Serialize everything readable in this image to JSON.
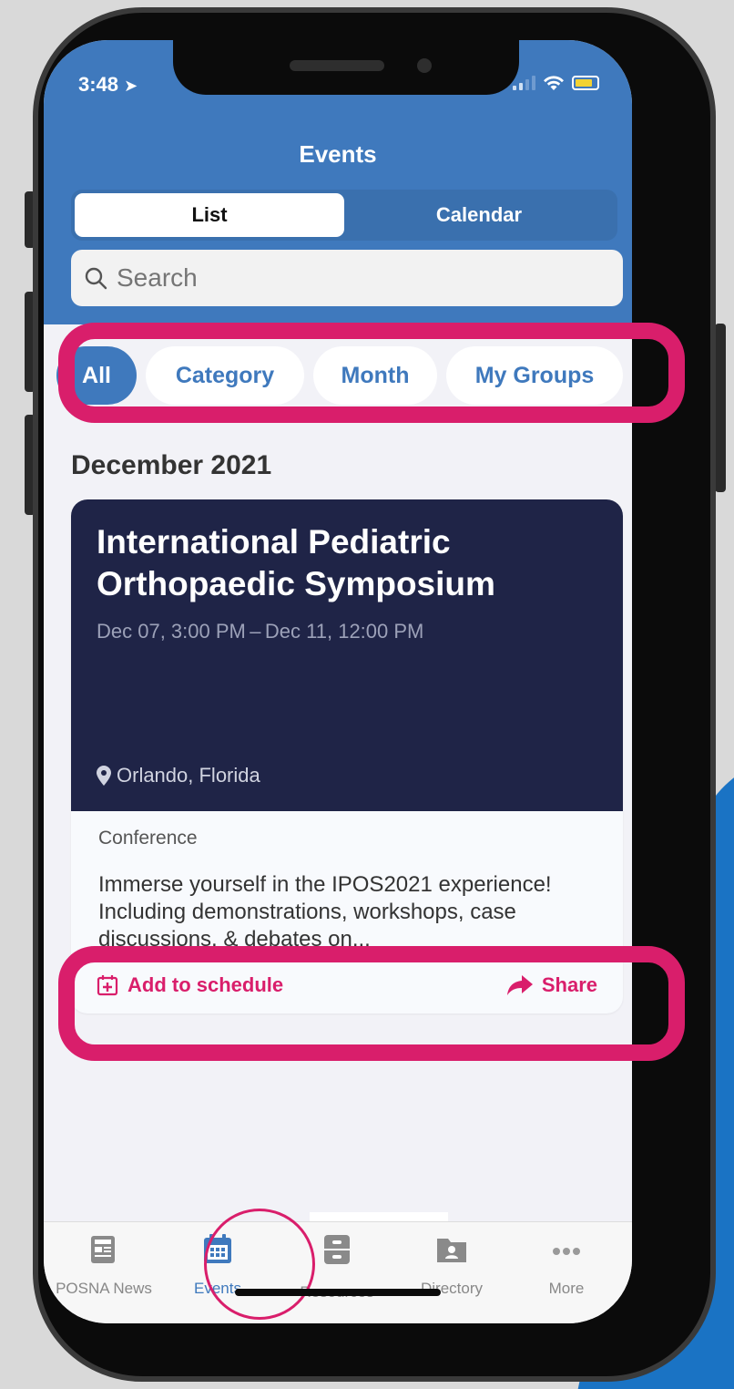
{
  "status": {
    "time": "3:48"
  },
  "header": {
    "title": "Events"
  },
  "view_toggle": {
    "list": "List",
    "calendar": "Calendar"
  },
  "search": {
    "placeholder": "Search"
  },
  "filters": [
    "All",
    "Category",
    "Month",
    "My Groups"
  ],
  "section": {
    "month": "December 2021"
  },
  "event": {
    "title": "International Pediatric Orthopaedic Symposium",
    "date": "Dec 07, 3:00 PM – Dec 11, 12:00 PM",
    "location": "Orlando, Florida",
    "category": "Conference",
    "description": "Immerse yourself in the IPOS2021 experience! Including demonstrations, workshops, case discussions, & debates on...",
    "add_label": "Add to schedule",
    "share_label": "Share"
  },
  "tabs": {
    "news": "POSNA News",
    "events": "Events",
    "resources": "Resources",
    "directory": "Directory",
    "more": "More"
  },
  "colors": {
    "accent": "#3f79bd",
    "highlight": "#d91e6b",
    "card_dark": "#1f2447"
  }
}
